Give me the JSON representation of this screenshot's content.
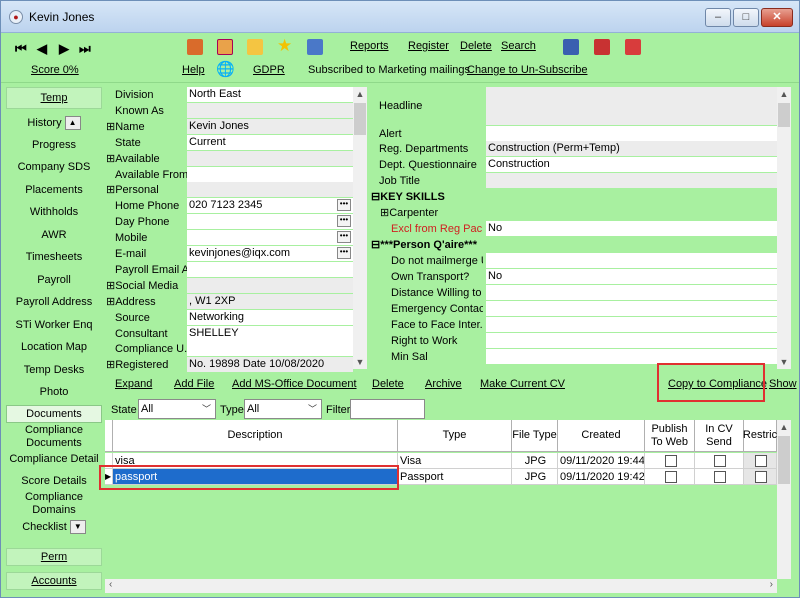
{
  "window": {
    "title": "Kevin Jones",
    "min_label": "–",
    "max_label": "□",
    "close_label": "✕"
  },
  "toolbar": {
    "score": "Score 0%",
    "links_top": [
      "Reports",
      "Register",
      "Delete",
      "Search"
    ],
    "help": "Help",
    "gdpr": "GDPR",
    "marketing_text": "Subscribed to Marketing mailings",
    "unsubscribe": "Change to Un-Subscribe"
  },
  "sidebar": {
    "temp": "Temp",
    "items": [
      "History",
      "Progress",
      "Company SDS",
      "Placements",
      "Withholds",
      "AWR",
      "Timesheets",
      "Payroll",
      "Payroll Address",
      "STi Worker Enq",
      "Location Map",
      "Temp Desks",
      "Photo",
      "Documents",
      "Compliance Documents",
      "Compliance Detail",
      "Score Details",
      "Compliance Domains",
      "Checklist"
    ],
    "perm": "Perm",
    "accounts": "Accounts"
  },
  "left_fields": [
    {
      "label": "Division",
      "value": "North East",
      "style": "white"
    },
    {
      "label": "Known As",
      "value": "",
      "style": "grey"
    },
    {
      "label": "⊞Name",
      "value": "Kevin Jones",
      "style": "grey"
    },
    {
      "label": "State",
      "value": "Current",
      "style": "white"
    },
    {
      "label": "⊞Available",
      "value": "",
      "style": "grey"
    },
    {
      "label": "Available From",
      "value": "",
      "style": "white"
    },
    {
      "label": "⊞Personal",
      "value": "",
      "style": "grey"
    },
    {
      "label": "Home Phone",
      "value": "020 7123 2345",
      "style": "white"
    },
    {
      "label": "Day Phone",
      "value": "",
      "style": "white"
    },
    {
      "label": "Mobile",
      "value": "",
      "style": "white"
    },
    {
      "label": "E-mail",
      "value": "kevinjones@iqx.com",
      "style": "white"
    },
    {
      "label": "Payroll Email A...",
      "value": "",
      "style": "white"
    },
    {
      "label": "⊞Social Media",
      "value": "",
      "style": "grey"
    },
    {
      "label": "⊞Address",
      "value": ", W1 2XP",
      "style": "grey"
    },
    {
      "label": "Source",
      "value": "Networking",
      "style": "white"
    },
    {
      "label": "Consultant",
      "value": "SHELLEY",
      "style": "white"
    },
    {
      "label": "Compliance U...",
      "value": "",
      "style": "white"
    },
    {
      "label": "⊞Registered",
      "value": "No. 19898 Date 10/08/2020",
      "style": "grey"
    }
  ],
  "dots_label": "•••",
  "right_fields": [
    {
      "label": "Headline",
      "value": ""
    },
    {
      "label": "Alert",
      "value": ""
    },
    {
      "label": "Reg. Departments",
      "value": "Construction (Perm+Temp)"
    },
    {
      "label": "Dept. Questionnaire",
      "value": "Construction"
    },
    {
      "label": "Job Title",
      "value": ""
    },
    {
      "label": "⊟KEY SKILLS",
      "value": ""
    },
    {
      "label": "⊞Carpenter",
      "value": ""
    },
    {
      "label": "Excl from Reg Pac...",
      "value": "No"
    },
    {
      "label": "⊟***Person Q'aire***",
      "value": ""
    },
    {
      "label": "Do not mailmerge U...",
      "value": ""
    },
    {
      "label": "Own Transport?",
      "value": "No"
    },
    {
      "label": "Distance Willing to ...",
      "value": ""
    },
    {
      "label": "Emergency Contac...",
      "value": ""
    },
    {
      "label": "Face to Face Inter...",
      "value": ""
    },
    {
      "label": "Right to Work",
      "value": ""
    },
    {
      "label": "Min Sal",
      "value": ""
    }
  ],
  "docs": {
    "actions": [
      "Expand",
      "Add File",
      "Add MS-Office Document",
      "Delete",
      "Archive",
      "Make Current CV"
    ],
    "copy_to_compliance": "Copy to Compliance",
    "show": "Show",
    "state_label": "State",
    "state_value": "All",
    "type_label": "Type",
    "type_value": "All",
    "filter_label": "Filter",
    "filter_value": "",
    "columns": [
      "Description",
      "Type",
      "File Type",
      "Created",
      "Publish To Web",
      "In CV Send",
      "Restric"
    ],
    "rows": [
      {
        "description": "visa",
        "type": "Visa",
        "file_type": "JPG",
        "created": "09/11/2020 19:44"
      },
      {
        "description": "passport",
        "type": "Passport",
        "file_type": "JPG",
        "created": "09/11/2020 19:42"
      }
    ]
  },
  "colors": {
    "background": "#a8f0a0",
    "highlight": "#e03030",
    "selected_row": "#1e6ccc"
  }
}
